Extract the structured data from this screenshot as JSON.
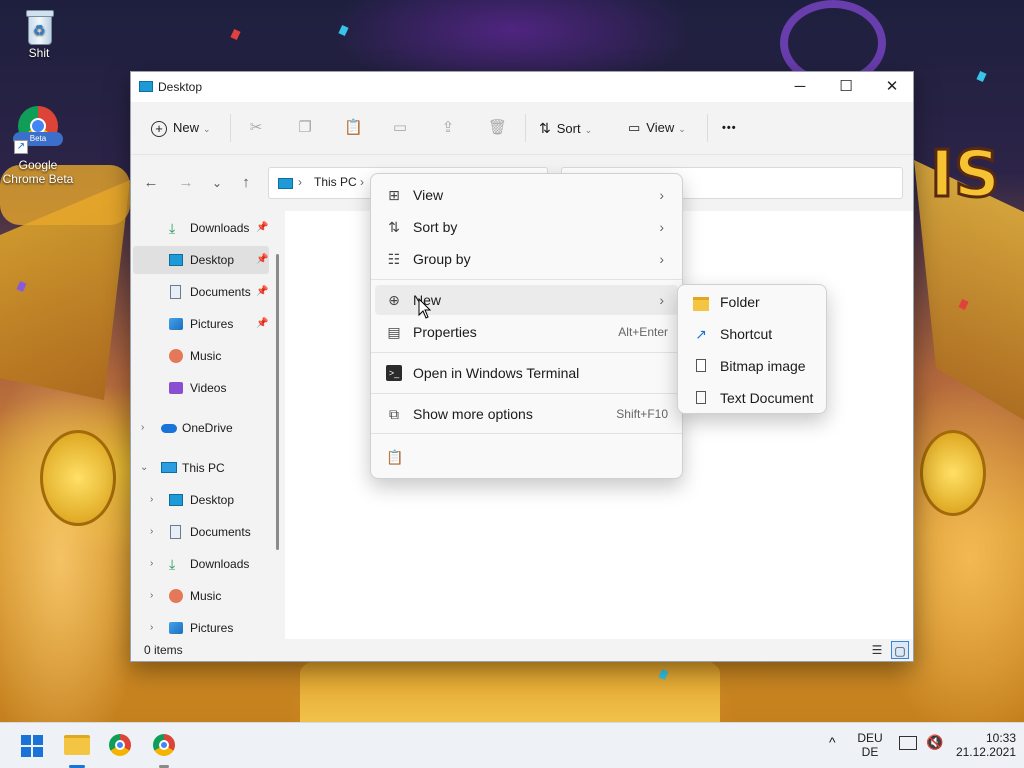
{
  "desktop": {
    "icons": [
      {
        "label": "Shit",
        "icon": "recycle-bin-icon"
      },
      {
        "label": "Google Chrome Beta",
        "badge": "Beta",
        "icon": "chrome-beta-icon"
      }
    ]
  },
  "window": {
    "title": "Desktop",
    "controls": {
      "minimize": "─",
      "maximize": "☐",
      "close": "✕"
    }
  },
  "toolbar": {
    "new_label": "New",
    "sort_label": "Sort",
    "view_label": "View",
    "more_label": "•••",
    "icons": [
      "cut-icon",
      "copy-icon",
      "paste-icon",
      "rename-icon",
      "share-icon",
      "delete-icon"
    ]
  },
  "navigation": {
    "back": "←",
    "forward": "→",
    "recent": "⌄",
    "up": "↑",
    "breadcrumb": [
      "This PC"
    ],
    "breadcrumb_sep": "›"
  },
  "sidebar": {
    "quick_access": [
      {
        "label": "Downloads",
        "icon": "downloads-icon",
        "pinned": true
      },
      {
        "label": "Desktop",
        "icon": "desktop-icon",
        "pinned": true,
        "selected": true
      },
      {
        "label": "Documents",
        "icon": "documents-icon",
        "pinned": true
      },
      {
        "label": "Pictures",
        "icon": "pictures-icon",
        "pinned": true
      },
      {
        "label": "Music",
        "icon": "music-icon",
        "pinned": false
      },
      {
        "label": "Videos",
        "icon": "videos-icon",
        "pinned": false
      }
    ],
    "onedrive": {
      "label": "OneDrive",
      "expanded": false
    },
    "this_pc": {
      "label": "This PC",
      "expanded": true
    },
    "this_pc_children": [
      {
        "label": "Desktop",
        "icon": "desktop-icon"
      },
      {
        "label": "Documents",
        "icon": "documents-icon"
      },
      {
        "label": "Downloads",
        "icon": "downloads-icon"
      },
      {
        "label": "Music",
        "icon": "music-icon"
      },
      {
        "label": "Pictures",
        "icon": "pictures-icon"
      }
    ]
  },
  "status": {
    "items": "0 items"
  },
  "context_menu": {
    "items": [
      {
        "label": "View",
        "icon": "view-grid-icon",
        "submenu": true
      },
      {
        "label": "Sort by",
        "icon": "sort-icon",
        "submenu": true
      },
      {
        "label": "Group by",
        "icon": "group-icon",
        "submenu": true
      },
      {
        "label": "New",
        "icon": "new-plus-icon",
        "submenu": true,
        "hover": true
      },
      {
        "label": "Properties",
        "icon": "properties-icon",
        "shortcut": "Alt+Enter"
      },
      {
        "label": "Open in Windows Terminal",
        "icon": "terminal-icon"
      },
      {
        "label": "Show more options",
        "icon": "more-options-icon",
        "shortcut": "Shift+F10"
      }
    ],
    "bottom_icon": "paste-icon"
  },
  "new_submenu": {
    "items": [
      {
        "label": "Folder",
        "icon": "folder-icon"
      },
      {
        "label": "Shortcut",
        "icon": "shortcut-icon"
      },
      {
        "label": "Bitmap image",
        "icon": "bitmap-icon"
      },
      {
        "label": "Text Document",
        "icon": "text-document-icon"
      }
    ]
  },
  "taskbar": {
    "language": "DEU",
    "layout": "DE",
    "time": "10:33",
    "date": "21.12.2021",
    "tray_chevron": "^"
  },
  "colors": {
    "accent": "#1a73d8",
    "folder": "#f4c542"
  }
}
